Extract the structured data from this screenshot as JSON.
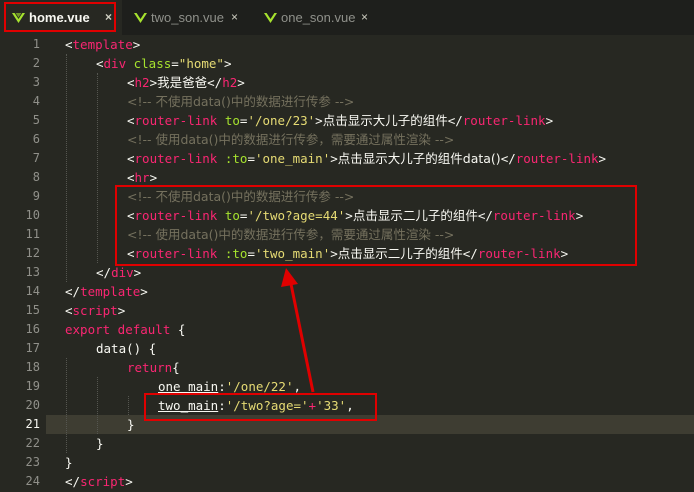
{
  "tabs": [
    {
      "label": "home.vue",
      "close": "×",
      "active": true
    },
    {
      "label": "two_son.vue",
      "close": "×",
      "active": false
    },
    {
      "label": "one_son.vue",
      "close": "×",
      "active": false
    }
  ],
  "editor": {
    "line_numbers": [
      "1",
      "2",
      "3",
      "4",
      "5",
      "6",
      "7",
      "8",
      "9",
      "10",
      "11",
      "12",
      "13",
      "14",
      "15",
      "16",
      "17",
      "18",
      "19",
      "20",
      "21",
      "22",
      "23",
      "24"
    ],
    "current_line": "21",
    "code": {
      "l1": {
        "open": "<",
        "tag": "template",
        "close": ">"
      },
      "l2": {
        "open": "<",
        "tag": "div",
        "attr": " class",
        "eq": "=",
        "val": "\"home\"",
        "close": ">"
      },
      "l3": {
        "open": "<",
        "tag": "h2",
        "close": ">",
        "text": "我是爸爸",
        "end_open": "</",
        "end_tag": "h2",
        "end_close": ">"
      },
      "l4": {
        "comment": "<!-- 不使用data()中的数据进行传参 -->"
      },
      "l5": {
        "open": "<",
        "tag": "router-link",
        "attr": " to",
        "eq": "=",
        "val": "'/one/23'",
        "close": ">",
        "text": "点击显示大儿子的组件",
        "end_open": "</",
        "end_tag": "router-link",
        "end_close": ">"
      },
      "l6": {
        "comment": "<!-- 使用data()中的数据进行传参，需要通过属性渲染 -->"
      },
      "l7": {
        "open": "<",
        "tag": "router-link",
        "attr": " :to",
        "eq": "=",
        "val": "'one_main'",
        "close": ">",
        "text": "点击显示大儿子的组件data()",
        "end_open": "</",
        "end_tag": "router-link",
        "end_close": ">"
      },
      "l8": {
        "open": "<",
        "tag": "hr",
        "close": ">"
      },
      "l9": {
        "comment": "<!-- 不使用data()中的数据进行传参 -->"
      },
      "l10": {
        "open": "<",
        "tag": "router-link",
        "attr": " to",
        "eq": "=",
        "val": "'/two?age=44'",
        "close": ">",
        "text": "点击显示二儿子的组件",
        "end_open": "</",
        "end_tag": "router-link",
        "end_close": ">"
      },
      "l11": {
        "comment": "<!-- 使用data()中的数据进行传参，需要通过属性渲染 -->"
      },
      "l12": {
        "open": "<",
        "tag": "router-link",
        "attr": " :to",
        "eq": "=",
        "val": "'two_main'",
        "close": ">",
        "text": "点击显示二儿子的组件",
        "end_open": "</",
        "end_tag": "router-link",
        "end_close": ">"
      },
      "l13": {
        "open": "</",
        "tag": "div",
        "close": ">"
      },
      "l14": {
        "open": "</",
        "tag": "template",
        "close": ">"
      },
      "l15": {
        "open": "<",
        "tag": "script",
        "close": ">"
      },
      "l16": {
        "kw1": "export",
        "kw2": " default",
        "rest": " {"
      },
      "l17": {
        "fn": "data",
        "rest": "() {"
      },
      "l18": {
        "kw": "return",
        "rest": "{"
      },
      "l19": {
        "key": "one_main",
        "colon": ":",
        "val": "'/one/22'",
        "rest": ","
      },
      "l20": {
        "key": "two_main",
        "colon": ":",
        "val": "'/two?age='",
        "plus": "+",
        "val2": "'33'",
        "rest": ","
      },
      "l21": {
        "text": "}"
      },
      "l22": {
        "text": "}"
      },
      "l23": {
        "text": "}"
      },
      "l24": {
        "open": "</",
        "tag": "script",
        "close": ">"
      }
    }
  },
  "colors": {
    "background": "#272822",
    "tag": "#f92672",
    "attribute": "#a6e22e",
    "string": "#e6db74",
    "comment": "#75715e",
    "highlight_box": "#e00000",
    "vue_icon": "#a6e22e"
  }
}
